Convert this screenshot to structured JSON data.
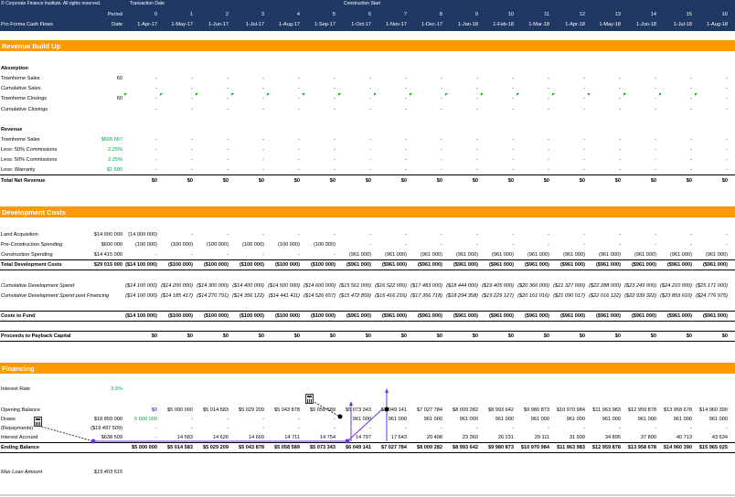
{
  "header": {
    "copyright": "© Corporate Finance Institute. All rights reserved.",
    "transaction_date": "Transaction Date",
    "construction_start": "Construction Start",
    "period_label": "Period",
    "date_label": "Date",
    "sheet_title": "Pro Forma Cash Flows",
    "periods": [
      "0",
      "1",
      "2",
      "3",
      "4",
      "5",
      "6",
      "7",
      "8",
      "9",
      "10",
      "11",
      "12",
      "13",
      "14",
      "15",
      "16"
    ],
    "dates": [
      "1-Apr-17",
      "1-May-17",
      "1-Jun-17",
      "1-Jul-17",
      "1-Aug-17",
      "1-Sep-17",
      "1-Oct-17",
      "1-Nov-17",
      "1-Dec-17",
      "1-Jan-18",
      "1-Feb-18",
      "1-Mar-18",
      "1-Apr-18",
      "1-May-18",
      "1-Jun-18",
      "1-Jul-18",
      "1-Aug-18"
    ]
  },
  "sections": {
    "revenue_build_up": "Revenue Build Up",
    "development_costs": "Development Costs",
    "financing": "Financing"
  },
  "absorption": {
    "title": "Absorption",
    "townhome_sales": "Townhome Sales",
    "townhome_sales_val": "60",
    "cumulative_sales": "Cumulative Sales",
    "townhome_closings": "Townhome Closings",
    "townhome_closings_val": "60",
    "cumulative_closings": "Cumulative Closings",
    "dash": "-"
  },
  "revenue": {
    "title": "Revenue",
    "townhome_sales": "Townhome Sales",
    "townhome_sales_val": "$666 667",
    "less_commissions_1": "Less: 50% Commissions",
    "less_commissions_1_val": "2.25%",
    "less_commissions_2": "Less: 50% Commissions",
    "less_commissions_2_val": "2.25%",
    "less_warranty": "Less: Warranty",
    "less_warranty_val": "$1 500",
    "total_net_revenue": "Total Net Revenue",
    "zero": "$0"
  },
  "dev_costs": {
    "land_acquisition": "Land Acquisition",
    "land_acquisition_val": "$14 000 000",
    "land_row": [
      "(14 000 000)",
      "-",
      "-",
      "-",
      "-",
      "-",
      "-",
      "-",
      "-",
      "-",
      "-",
      "-",
      "-",
      "-",
      "-",
      "-",
      "-"
    ],
    "pre_construction": "Pre-Construction Spending",
    "pre_construction_val": "$600 000",
    "pre_row": [
      "(100 000)",
      "(100 000)",
      "(100 000)",
      "(100 000)",
      "(100 000)",
      "(100 000)",
      "-",
      "-",
      "-",
      "-",
      "-",
      "-",
      "-",
      "-",
      "-",
      "-",
      "-"
    ],
    "construction": "Construction Spending",
    "construction_val": "$14 415 000",
    "cons_row": [
      "-",
      "-",
      "-",
      "-",
      "-",
      "-",
      "(961 000)",
      "(961 000)",
      "(961 000)",
      "(961 000)",
      "(961 000)",
      "(961 000)",
      "(961 000)",
      "(961 000)",
      "(961 000)",
      "(961 000)",
      "(961 000)"
    ],
    "total_label": "Total Development Costs",
    "total_val": "$29 015 000",
    "total_row": [
      "($14 100 000)",
      "($100 000)",
      "($100 000)",
      "($100 000)",
      "($100 000)",
      "($100 000)",
      "($961 000)",
      "($961 000)",
      "($961 000)",
      "($961 000)",
      "($961 000)",
      "($961 000)",
      "($961 000)",
      "($961 000)",
      "($961 000)",
      "($961 000)",
      "($961 000)"
    ],
    "cum_spend_label": "Cumulative Development Spend",
    "cum_spend_row": [
      "($14 100 000)",
      "($14 200 000)",
      "($14 300 000)",
      "($14 400 000)",
      "($14 500 000)",
      "($14 600 000)",
      "($15 561 000)",
      "($16 522 000)",
      "($17 483 000)",
      "($18 444 000)",
      "($19 405 000)",
      "($20 366 000)",
      "($21 327 000)",
      "($22 288 000)",
      "($23 249 000)",
      "($24 210 000)",
      "($25 171 000)"
    ],
    "cum_fin_label": "Cumulative Development Spend post Financing",
    "cum_fin_row": [
      "($14 100 000)",
      "($14 185 417)",
      "($14 270 791)",
      "($14 356 122)",
      "($14 441 411)",
      "($14 526 657)",
      "($15 472 859)",
      "($16 416 216)",
      "($17 356 718)",
      "($18 294 358)",
      "($19 229 127)",
      "($20 161 016)",
      "($21 090 017)",
      "($22 016 122)",
      "($22 939 322)",
      "($23 859 610)",
      "($24 776 975)"
    ],
    "costs_to_fund": "Costs to Fund",
    "ctf_row": [
      "($14 100 000)",
      "($100 000)",
      "($100 000)",
      "($100 000)",
      "($100 000)",
      "($100 000)",
      "($961 000)",
      "($961 000)",
      "($961 000)",
      "($961 000)",
      "($961 000)",
      "($961 000)",
      "($961 000)",
      "($961 000)",
      "($961 000)",
      "($961 000)",
      "($961 000)"
    ],
    "proceeds": "Proceeds to Payback Capital",
    "zero": "$0"
  },
  "financing": {
    "interest_rate": "Interest Rate",
    "interest_rate_val": "3.5%",
    "opening_balance": "Opening Balance",
    "ob_row": [
      "$0",
      "$5 000 000",
      "$5 014 583",
      "$5 029 209",
      "$5 043 878",
      "$5 058 589",
      "$5 073 343",
      "$6 049 141",
      "$7 027 784",
      "$8 009 282",
      "$8 993 642",
      "$9 980 873",
      "$10 970 984",
      "$11 963 983",
      "$12 959 878",
      "$13 958 678",
      "$14 960 390"
    ],
    "draws": "Draws",
    "draws_val": "$18 859 000",
    "draws_row": [
      "5 000 000",
      "-",
      "-",
      "-",
      "-",
      "-",
      "961 000",
      "961 000",
      "961 000",
      "961 000",
      "961 000",
      "961 000",
      "961 000",
      "961 000",
      "961 000",
      "961 000",
      "961 000"
    ],
    "repayments": "(Repayments)",
    "repayments_val": "($19 497 509)",
    "rep_row": [
      "-",
      "-",
      "-",
      "-",
      "-",
      "-",
      "-",
      "-",
      "-",
      "-",
      "-",
      "-",
      "-",
      "-",
      "-",
      "-",
      "-"
    ],
    "interest_accrued": "Interest Accrued",
    "interest_accrued_val": "$638 509",
    "ia_row": [
      "-",
      "14 583",
      "14 626",
      "14 669",
      "14 711",
      "14 754",
      "14 797",
      "17 643",
      "20 498",
      "23 360",
      "26 231",
      "29 111",
      "31 999",
      "34 895",
      "37 800",
      "40 713",
      "43 634"
    ],
    "ending_balance": "Ending Balance",
    "eb_row": [
      "$5 000 000",
      "$5 014 583",
      "$5 029 209",
      "$5 043 878",
      "$5 058 589",
      "$5 073 343",
      "$6 049 141",
      "$7 027 784",
      "$8 009 282",
      "$8 993 642",
      "$9 980 873",
      "$10 970 984",
      "$11 963 983",
      "$12 959 878",
      "$13 958 678",
      "$14 960 390",
      "$15 965 025"
    ],
    "max_loan": "Max Loan Amount",
    "max_loan_val": "$19 403 515"
  },
  "colors": {
    "header_bg": "#1f3864",
    "band": "#ff9900",
    "input_green": "#00a650",
    "link_blue": "#0000ff",
    "arrow_purple": "#7b2ff7"
  }
}
